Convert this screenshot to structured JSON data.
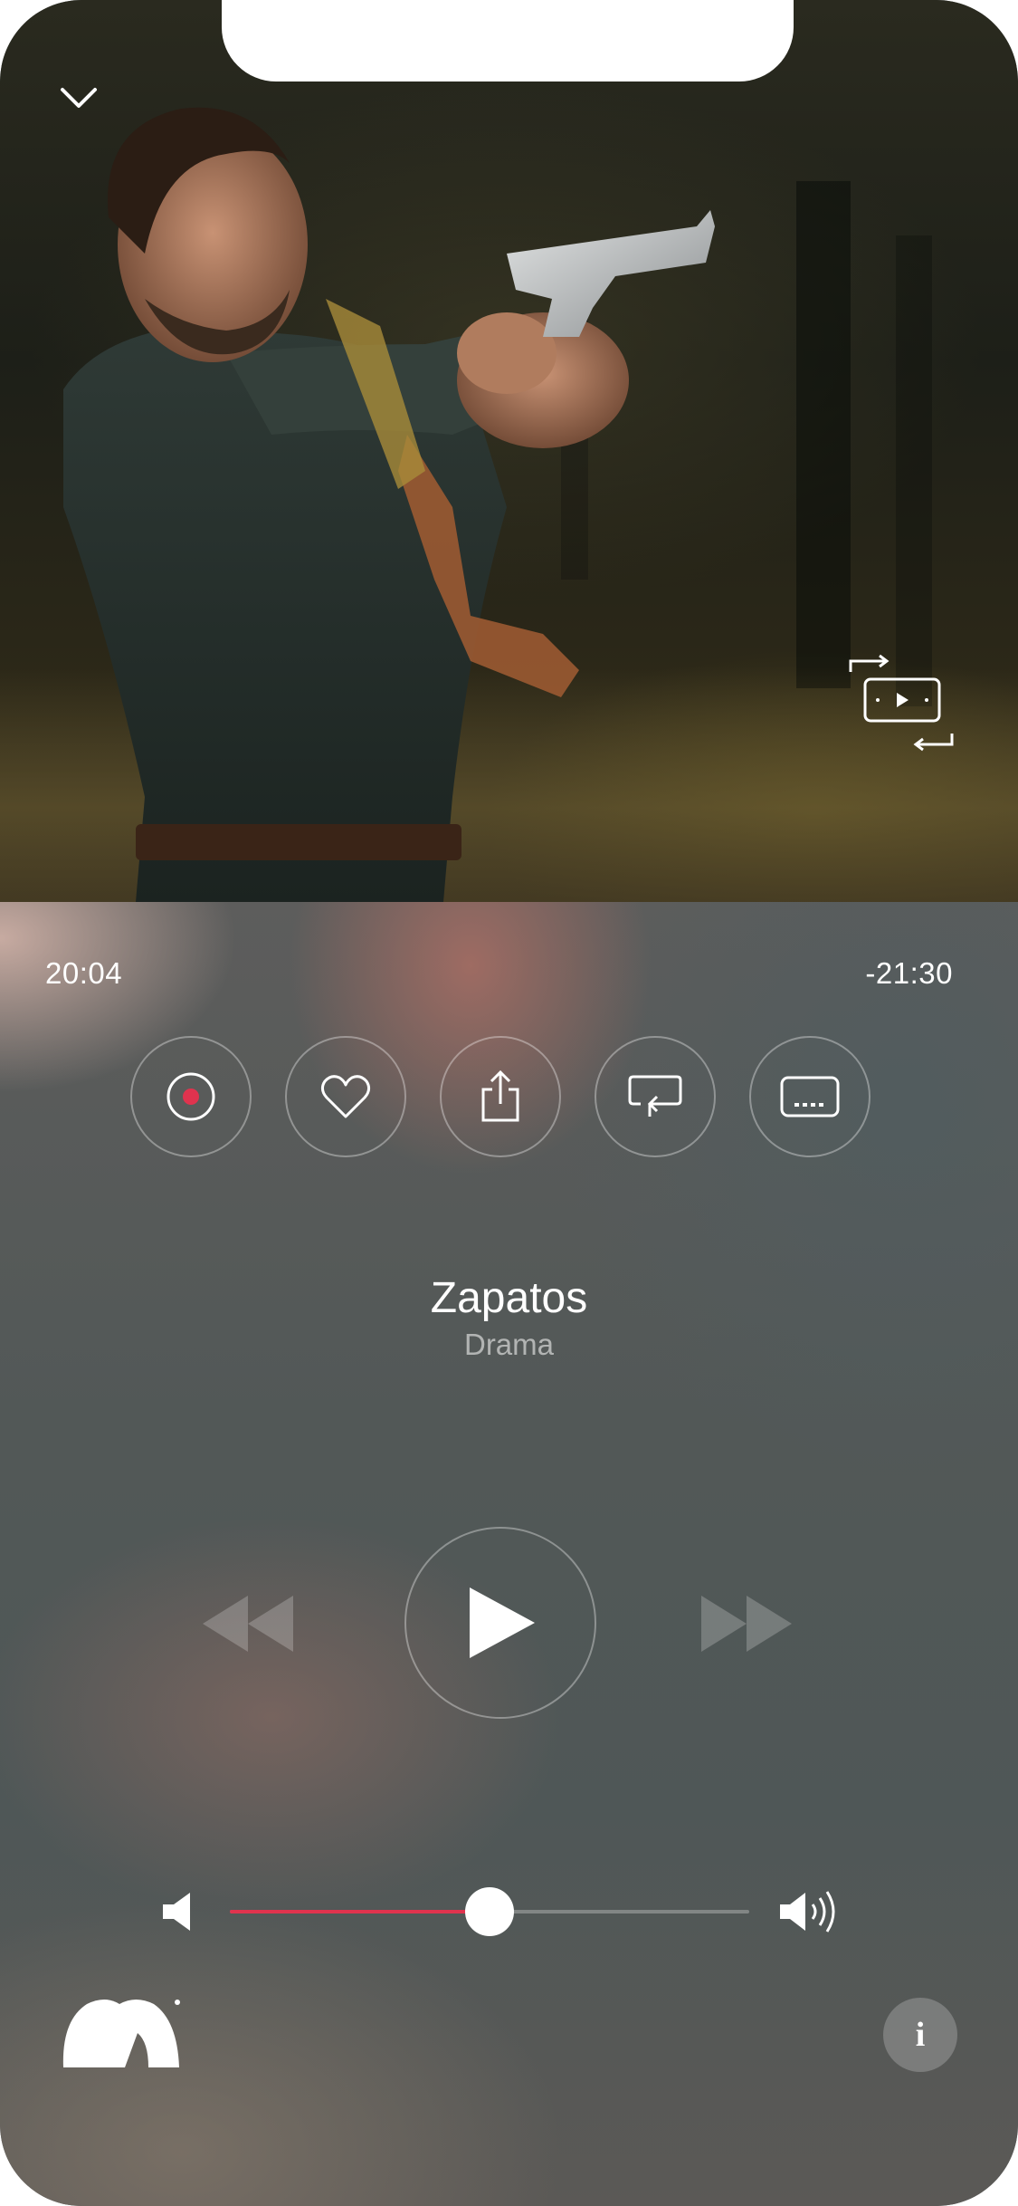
{
  "player": {
    "elapsed": "20:04",
    "remaining": "-21:30",
    "title": "Zapatos",
    "genre": "Drama",
    "volume_level": 0.5,
    "accent_color": "#e0334e"
  },
  "actions": [
    {
      "name": "record-icon"
    },
    {
      "name": "heart-icon"
    },
    {
      "name": "share-icon"
    },
    {
      "name": "repeat-icon"
    },
    {
      "name": "subtitles-icon"
    }
  ],
  "icons": {
    "collapse": "chevron-down-icon",
    "pip": "picture-in-picture-icon",
    "rewind": "rewind-icon",
    "play": "play-icon",
    "forward": "fast-forward-icon",
    "volume_low": "volume-low-icon",
    "volume_high": "volume-high-icon",
    "info": "info-icon"
  },
  "info_glyph": "i"
}
